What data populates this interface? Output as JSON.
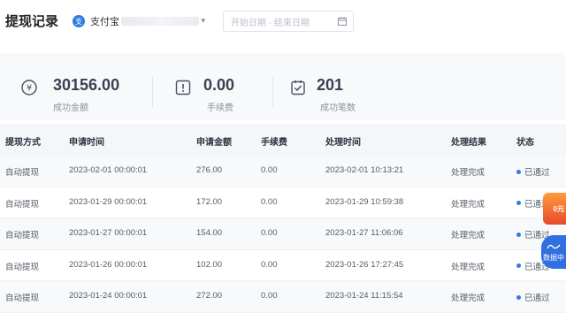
{
  "header": {
    "title": "提现记录",
    "account_name": "支付宝",
    "date_placeholder": "开始日期 - 结束日期"
  },
  "stats": [
    {
      "icon": "yen-icon",
      "value": "30156.00",
      "label": "成功金额"
    },
    {
      "icon": "alert-box-icon",
      "value": "0.00",
      "label": "手续费"
    },
    {
      "icon": "clipboard-check-icon",
      "value": "201",
      "label": "成功笔数"
    }
  ],
  "table": {
    "columns": [
      "提现方式",
      "申请时间",
      "申请金额",
      "手续费",
      "处理时间",
      "处理结果",
      "状态"
    ],
    "rows": [
      {
        "method": "自动提现",
        "apply_time": "2023-02-01 00:00:01",
        "amount": "276.00",
        "fee": "0.00",
        "process_time": "2023-02-01 10:13:21",
        "result": "处理完成",
        "status": "已通过"
      },
      {
        "method": "自动提现",
        "apply_time": "2023-01-29 00:00:01",
        "amount": "172.00",
        "fee": "0.00",
        "process_time": "2023-01-29 10:59:38",
        "result": "处理完成",
        "status": "已通过"
      },
      {
        "method": "自动提现",
        "apply_time": "2023-01-27 00:00:01",
        "amount": "154.00",
        "fee": "0.00",
        "process_time": "2023-01-27 11:06:06",
        "result": "处理完成",
        "status": "已通过"
      },
      {
        "method": "自动提现",
        "apply_time": "2023-01-26 00:00:01",
        "amount": "102.00",
        "fee": "0.00",
        "process_time": "2023-01-26 17:27:45",
        "result": "处理完成",
        "status": "已通过"
      },
      {
        "method": "自动提现",
        "apply_time": "2023-01-24 00:00:01",
        "amount": "272.00",
        "fee": "0.00",
        "process_time": "2023-01-24 11:15:54",
        "result": "处理完成",
        "status": "已通过"
      }
    ]
  },
  "side": {
    "promo": "0元",
    "data_label": "数据中"
  },
  "colors": {
    "accent": "#2f7de1",
    "stats_bg": "#f7f9fb",
    "header_bg": "#f4f6f9"
  }
}
